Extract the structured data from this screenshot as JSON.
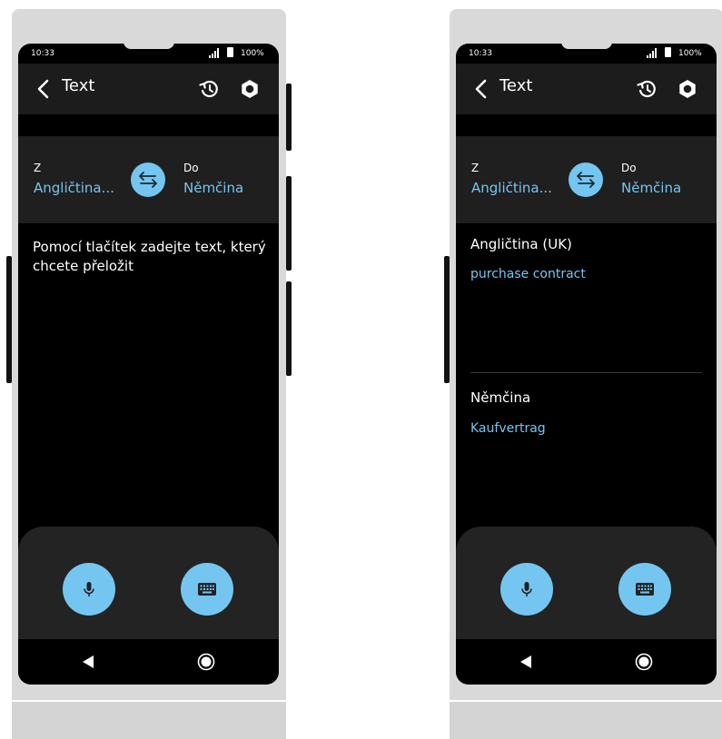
{
  "status": {
    "time": "10:33",
    "battery": "100%"
  },
  "appbar": {
    "title": "Text"
  },
  "languages": {
    "from_label": "Z",
    "from_value": "Angličtina...",
    "to_label": "Do",
    "to_value": "Němčina"
  },
  "screen1": {
    "hint": "Pomocí tlačítek zadejte text, který chcete přeložit"
  },
  "screen2": {
    "source_label": "Angličtina (UK)",
    "source_text": "purchase contract",
    "target_label": "Němčina",
    "target_text": "Kaufvertrag"
  },
  "icons": [
    "back-icon",
    "history-icon",
    "settings-icon",
    "swap-icon",
    "mic-icon",
    "keyboard-icon",
    "nav-back-icon",
    "nav-home-icon"
  ],
  "colors": {
    "accent": "#74c6f0",
    "appbar": "#1c1c1c",
    "panel": "#232323",
    "device": "#d9d9d9"
  }
}
